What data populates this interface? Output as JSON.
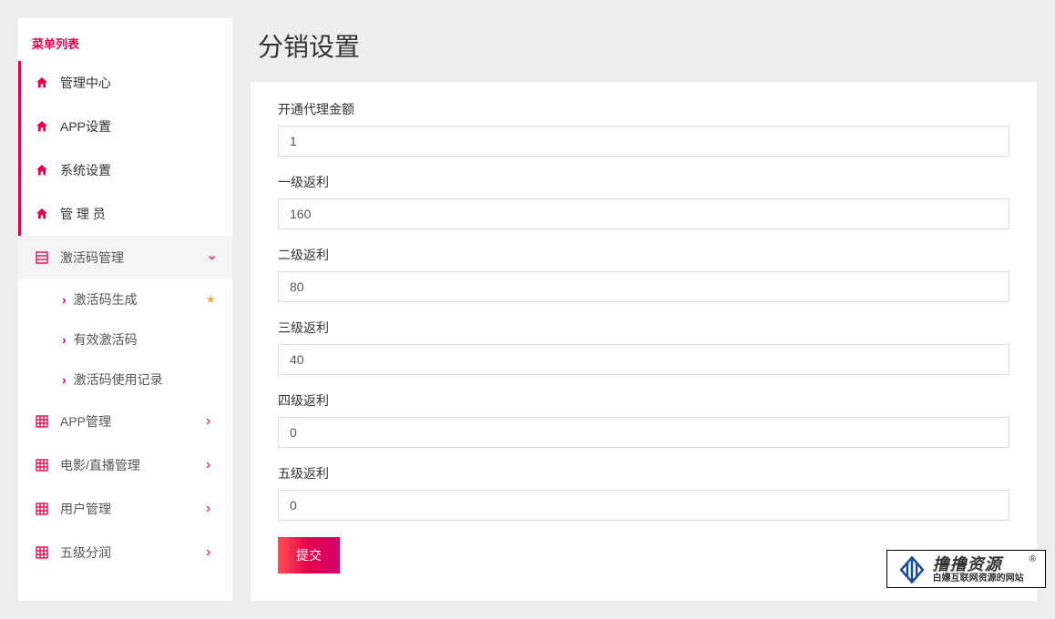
{
  "sidebar": {
    "header": "菜单列表",
    "items": [
      {
        "label": "管理中心",
        "icon": "home",
        "accent": true
      },
      {
        "label": "APP设置",
        "icon": "home",
        "accent": true
      },
      {
        "label": "系统设置",
        "icon": "home",
        "accent": true
      },
      {
        "label": "管  理  员",
        "icon": "home",
        "accent": true
      },
      {
        "label": "激活码管理",
        "icon": "list",
        "accent": false,
        "expanded": true,
        "children": [
          {
            "label": "激活码生成",
            "star": true
          },
          {
            "label": "有效激活码",
            "star": false
          },
          {
            "label": "激活码使用记录",
            "star": false
          }
        ]
      },
      {
        "label": "APP管理",
        "icon": "grid",
        "accent": false,
        "chevron": "right"
      },
      {
        "label": "电影/直播管理",
        "icon": "grid",
        "accent": false,
        "chevron": "right"
      },
      {
        "label": "用户管理",
        "icon": "grid",
        "accent": false,
        "chevron": "right"
      },
      {
        "label": "五级分润",
        "icon": "grid",
        "accent": false,
        "chevron": "right"
      }
    ]
  },
  "page": {
    "title": "分销设置"
  },
  "form": {
    "fields": [
      {
        "label": "开通代理金额",
        "value": "1"
      },
      {
        "label": "一级返利",
        "value": "160"
      },
      {
        "label": "二级返利",
        "value": "80"
      },
      {
        "label": "三级返利",
        "value": "40"
      },
      {
        "label": "四级返利",
        "value": "0"
      },
      {
        "label": "五级返利",
        "value": "0"
      }
    ],
    "submit_label": "提交"
  },
  "watermark": {
    "main": "撸撸资源",
    "sub": "白嫖互联网资源的网站",
    "reg": "®"
  },
  "colors": {
    "accent": "#e6004c",
    "bg": "#eeeeee"
  }
}
